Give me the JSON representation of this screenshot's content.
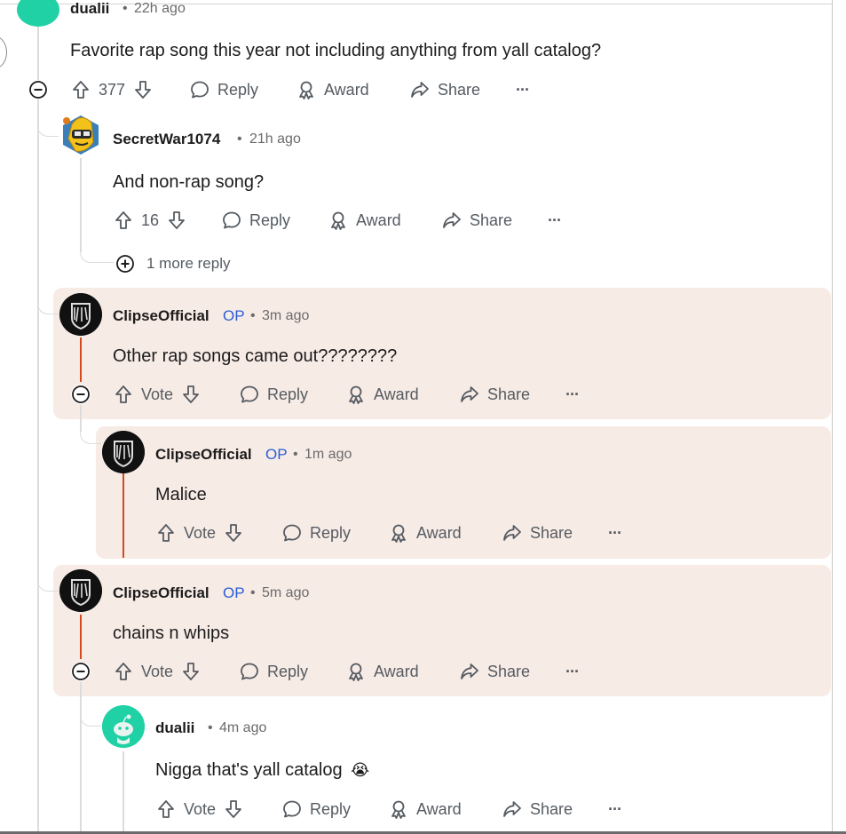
{
  "comments": {
    "c1": {
      "username": "dualii",
      "time": "22h ago",
      "body": "Favorite rap song this year not including anything from yall catalog?",
      "score": "377",
      "reply_label": "Reply",
      "award_label": "Award",
      "share_label": "Share",
      "more_label": "···"
    },
    "c2": {
      "username": "SecretWar1074",
      "time": "21h ago",
      "body": "And non-rap song?",
      "score": "16",
      "reply_label": "Reply",
      "award_label": "Award",
      "share_label": "Share",
      "more_label": "···",
      "more_replies": "1 more reply"
    },
    "c3": {
      "username": "ClipseOfficial",
      "op": "OP",
      "time": "3m ago",
      "body": "Other rap songs came out????????",
      "score": "Vote",
      "reply_label": "Reply",
      "award_label": "Award",
      "share_label": "Share",
      "more_label": "···"
    },
    "c4": {
      "username": "ClipseOfficial",
      "op": "OP",
      "time": "1m ago",
      "body": "Malice",
      "score": "Vote",
      "reply_label": "Reply",
      "award_label": "Award",
      "share_label": "Share",
      "more_label": "···"
    },
    "c5": {
      "username": "ClipseOfficial",
      "op": "OP",
      "time": "5m ago",
      "body": "chains n whips",
      "score": "Vote",
      "reply_label": "Reply",
      "award_label": "Award",
      "share_label": "Share",
      "more_label": "···"
    },
    "c6": {
      "username": "dualii",
      "time": "4m ago",
      "body": "Nigga that's yall catalog",
      "emoji": "😭",
      "score": "Vote",
      "reply_label": "Reply",
      "award_label": "Award",
      "share_label": "Share",
      "more_label": "···"
    }
  },
  "dot": "•",
  "colors": {
    "op_blue": "#2a5dd6",
    "highlight": "#f7ebe6",
    "thread_red": "#d44a1e",
    "snoo_green": "#1fd1a5"
  }
}
